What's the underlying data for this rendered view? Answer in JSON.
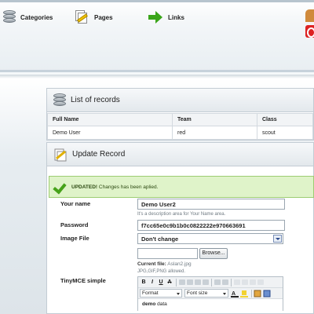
{
  "nav": {
    "categories": "Categories",
    "pages": "Pages",
    "links": "Links"
  },
  "records": {
    "title": "List of records",
    "columns": [
      "Full Name",
      "Team",
      "Class"
    ],
    "rows": [
      [
        "Demo User",
        "red",
        "scout"
      ]
    ]
  },
  "update": {
    "title": "Update Record",
    "success": {
      "strong": "UPDATED!",
      "text": "Changes has been aplied."
    },
    "fields": {
      "name": {
        "label": "Your name",
        "value": "Demo User2",
        "hint": "It's a description area for Your Name area."
      },
      "password": {
        "label": "Password",
        "value": "f7cc65e0c9b1b0c0822222e970663691"
      },
      "image": {
        "label": "Image File",
        "select_value": "Don't change",
        "browse": "Browse...",
        "current_label": "Current file:",
        "current_value": "Aslan2.jpg",
        "allowed": "JPG,GIF,PNG allowed."
      },
      "tinymce": {
        "label": "TinyMCE simple",
        "format": "Format",
        "font_size": "Font size",
        "content_bold": "demo",
        "content_rest": " data"
      }
    }
  },
  "colors": {
    "success_bg": "#dff3c9",
    "success_border": "#9ccc72",
    "check": "#46a21a"
  },
  "icons": [
    "database-icon",
    "pages-icon",
    "links-arrow-icon",
    "user-icon",
    "power-icon",
    "edit-icon",
    "check-icon"
  ]
}
